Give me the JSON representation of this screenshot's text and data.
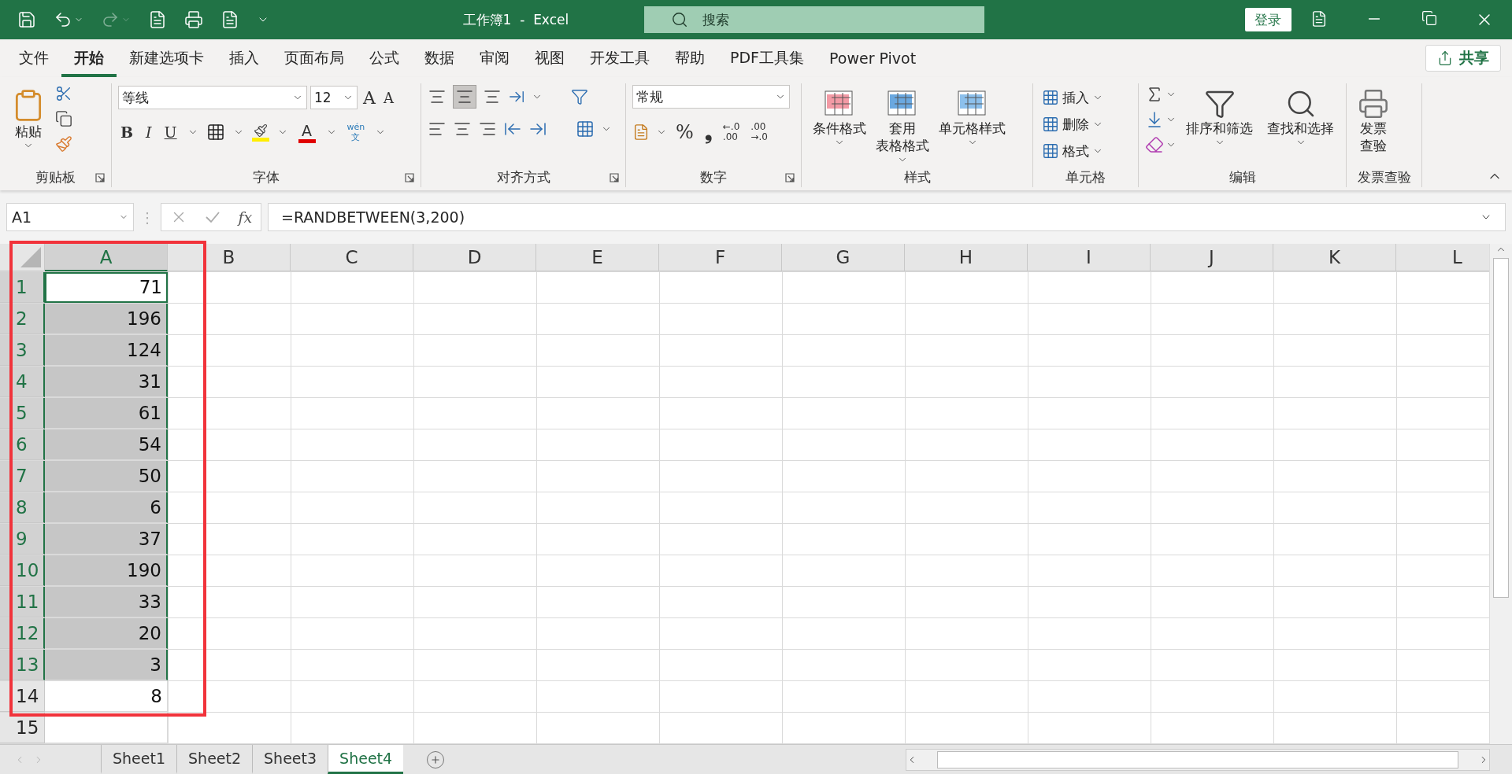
{
  "title_bar": {
    "title": "工作簿1  -  Excel",
    "search_placeholder": "搜索",
    "sign_in": "登录"
  },
  "ribbon_tabs": [
    {
      "label": "文件",
      "selected": false
    },
    {
      "label": "开始",
      "selected": true
    },
    {
      "label": "新建选项卡",
      "selected": false
    },
    {
      "label": "插入",
      "selected": false
    },
    {
      "label": "页面布局",
      "selected": false
    },
    {
      "label": "公式",
      "selected": false
    },
    {
      "label": "数据",
      "selected": false
    },
    {
      "label": "审阅",
      "selected": false
    },
    {
      "label": "视图",
      "selected": false
    },
    {
      "label": "开发工具",
      "selected": false
    },
    {
      "label": "帮助",
      "selected": false
    },
    {
      "label": "PDF工具集",
      "selected": false
    },
    {
      "label": "Power Pivot",
      "selected": false
    }
  ],
  "share_button": "共享",
  "ribbon_groups": [
    {
      "kind": "clipboard",
      "label": "剪贴板",
      "launcher": true,
      "paste": "粘贴"
    },
    {
      "kind": "font",
      "label": "字体",
      "launcher": true,
      "font_name": "等线",
      "font_size": "12",
      "grow": "A",
      "shrink": "A",
      "bold": "B",
      "italic": "I",
      "underline": "U",
      "font_color": "A",
      "phonetic_top": "wén",
      "phonetic_bottom": "文"
    },
    {
      "kind": "alignment",
      "label": "对齐方式",
      "launcher": true
    },
    {
      "kind": "number",
      "label": "数字",
      "launcher": true,
      "format": "常规",
      "percent": "%",
      "comma": "❟",
      "decimals": [
        {
          "top": "←.0",
          "bottom": ".00"
        },
        {
          "top": ".00",
          "bottom": "→.0"
        }
      ]
    },
    {
      "kind": "styles",
      "label": "样式",
      "launcher": false,
      "buttons": [
        {
          "lines": [
            "条件格式"
          ]
        },
        {
          "lines": [
            "套用",
            "表格格式"
          ]
        },
        {
          "lines": [
            "单元格样式"
          ]
        }
      ]
    },
    {
      "kind": "cells",
      "label": "单元格",
      "launcher": false,
      "buttons": [
        "插入",
        "删除",
        "格式"
      ]
    },
    {
      "kind": "editing",
      "label": "编辑",
      "launcher": false,
      "buttons": [
        "排序和筛选",
        "查找和选择"
      ]
    },
    {
      "kind": "invoice",
      "label": "发票查验",
      "launcher": false,
      "lines": [
        "发票",
        "查验"
      ]
    }
  ],
  "formula_bar": {
    "name_box": "A1",
    "separator": "⋮",
    "function_label": "fx",
    "formula": "=RANDBETWEEN(3,200)"
  },
  "columns": [
    {
      "label": "A",
      "selected": true
    },
    {
      "label": "B",
      "selected": false
    },
    {
      "label": "C",
      "selected": false
    },
    {
      "label": "D",
      "selected": false
    },
    {
      "label": "E",
      "selected": false
    },
    {
      "label": "F",
      "selected": false
    },
    {
      "label": "G",
      "selected": false
    },
    {
      "label": "H",
      "selected": false
    },
    {
      "label": "I",
      "selected": false
    },
    {
      "label": "J",
      "selected": false
    },
    {
      "label": "K",
      "selected": false
    },
    {
      "label": "L",
      "selected": false
    }
  ],
  "rows": [
    {
      "number": "1",
      "value": "71",
      "selected": true,
      "active": true
    },
    {
      "number": "2",
      "value": "196",
      "selected": true,
      "active": false
    },
    {
      "number": "3",
      "value": "124",
      "selected": true,
      "active": false
    },
    {
      "number": "4",
      "value": "31",
      "selected": true,
      "active": false
    },
    {
      "number": "5",
      "value": "61",
      "selected": true,
      "active": false
    },
    {
      "number": "6",
      "value": "54",
      "selected": true,
      "active": false
    },
    {
      "number": "7",
      "value": "50",
      "selected": true,
      "active": false
    },
    {
      "number": "8",
      "value": "6",
      "selected": true,
      "active": false
    },
    {
      "number": "9",
      "value": "37",
      "selected": true,
      "active": false
    },
    {
      "number": "10",
      "value": "190",
      "selected": true,
      "active": false
    },
    {
      "number": "11",
      "value": "33",
      "selected": true,
      "active": false
    },
    {
      "number": "12",
      "value": "20",
      "selected": true,
      "active": false
    },
    {
      "number": "13",
      "value": "3",
      "selected": true,
      "active": false
    },
    {
      "number": "14",
      "value": "8",
      "selected": false,
      "active": false
    },
    {
      "number": "15",
      "selected": false,
      "active": false
    }
  ],
  "sheets": [
    {
      "label": "Sheet1",
      "selected": false
    },
    {
      "label": "Sheet2",
      "selected": false
    },
    {
      "label": "Sheet3",
      "selected": false
    },
    {
      "label": "Sheet4",
      "selected": true
    }
  ]
}
